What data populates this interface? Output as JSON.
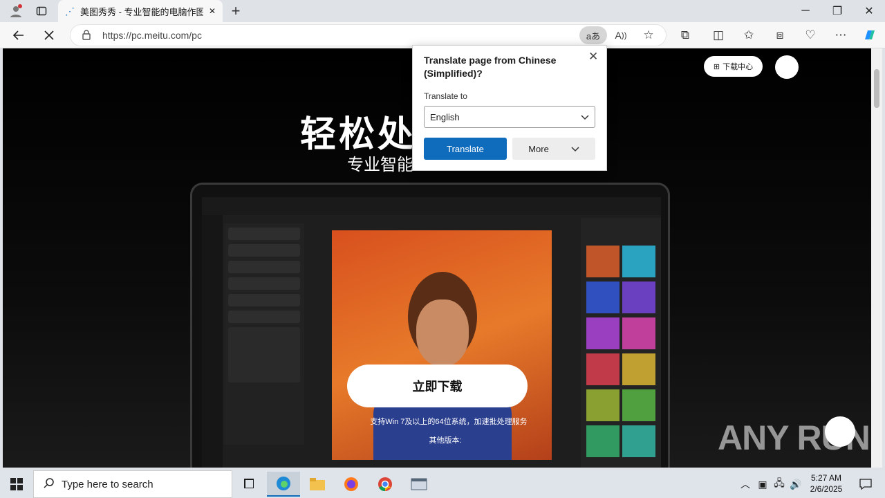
{
  "browser": {
    "tab_title": "美图秀秀 - 专业智能的电脑作图软件",
    "url": "https://pc.meitu.com/pc",
    "new_tab_symbol": "+",
    "close_tab_symbol": "✕"
  },
  "page": {
    "hero_title": "轻松处理",
    "hero_subtitle": "专业智能",
    "download_center": "下载中心",
    "download_button": "立即下载",
    "support_text": "支持Win 7及以上的64位系统，加速批处理服务",
    "other_versions": "其他版本:",
    "watermark": "ANY RUN"
  },
  "translate_popup": {
    "title": "Translate page from Chinese (Simplified)?",
    "translate_to_label": "Translate to",
    "selected_language": "English",
    "translate_button": "Translate",
    "more_button": "More"
  },
  "taskbar": {
    "search_placeholder": "Type here to search",
    "time": "5:27 AM",
    "date": "2/6/2025"
  },
  "colors": {
    "accent": "#0f6cbd",
    "page_bg": "#000000"
  }
}
